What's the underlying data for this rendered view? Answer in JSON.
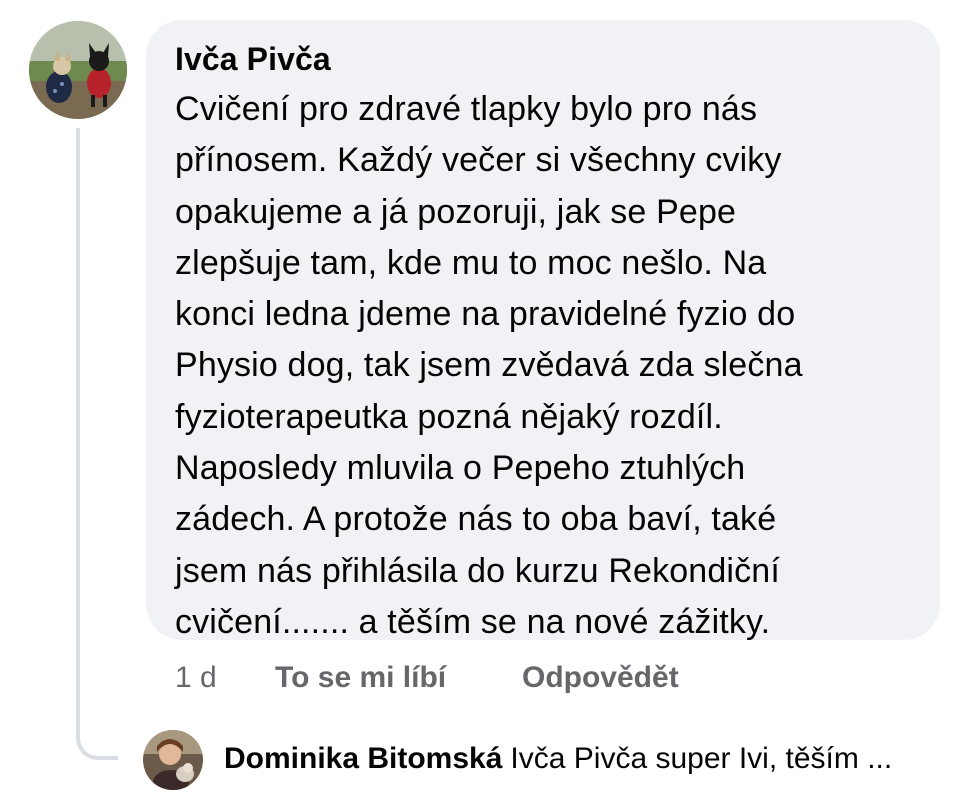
{
  "comment": {
    "author": "Ivča Pivča",
    "avatar_icon": "dogs-profile-photo",
    "lines": [
      "Cvičení pro zdravé tlapky bylo pro nás",
      "přínosem. Každý večer si všechny cviky",
      "opakujeme a já pozoruji, jak se Pepe",
      "zlepšuje tam, kde mu to moc nešlo. Na",
      "konci ledna jdeme na pravidelné fyzio do",
      "Physio dog, tak jsem zvědavá zda slečna",
      "fyzioterapeutka pozná nějaký rozdíl.",
      "Naposledy mluvila o Pepeho ztuhlých",
      "zádech. A protože nás to oba baví, také",
      "jsem nás přihlásila do kurzu Rekondiční",
      "cvičení....... a těším se na nové zážitky."
    ]
  },
  "actions": {
    "time": "1 d",
    "like": "To se mi líbí",
    "reply": "Odpovědět"
  },
  "reply": {
    "author": "Dominika Bitomská",
    "snippet": "Ivča Pivča super Ivi, těším ...",
    "avatar_icon": "person-with-dog-profile-photo"
  },
  "colors": {
    "bubble_background": "#f0f2f5",
    "secondary_text": "#65676b",
    "thread_line": "#dadde1"
  }
}
